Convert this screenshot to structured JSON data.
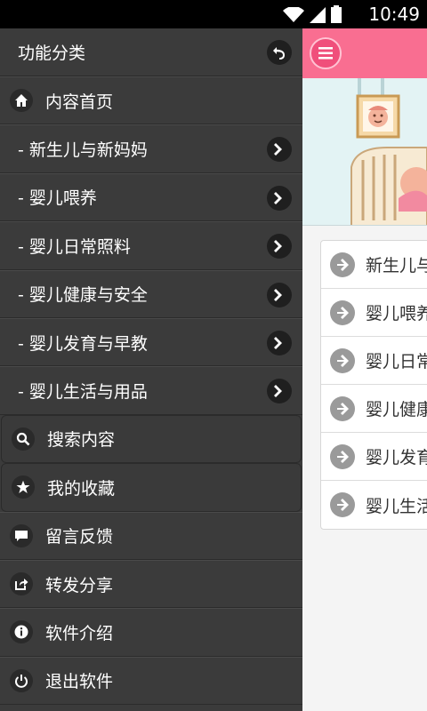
{
  "status_bar": {
    "time": "10:49",
    "icons": [
      "wifi-icon",
      "signal-icon",
      "battery-icon"
    ]
  },
  "colors": {
    "accent": "#f96e91",
    "drawer_bg": "#3b3b3b",
    "content_bg": "#f4f4f4"
  },
  "drawer": {
    "title": "功能分类",
    "header_icon": "undo-icon",
    "items": [
      {
        "label": "内容首页",
        "icon": "home-icon"
      },
      {
        "label": "- 新生儿与新妈妈",
        "has_chevron": true
      },
      {
        "label": "- 婴儿喂养",
        "has_chevron": true
      },
      {
        "label": "- 婴儿日常照料",
        "has_chevron": true
      },
      {
        "label": "- 婴儿健康与安全",
        "has_chevron": true
      },
      {
        "label": "- 婴儿发育与早教",
        "has_chevron": true
      },
      {
        "label": "- 婴儿生活与用品",
        "has_chevron": true
      },
      {
        "label": "搜索内容",
        "icon": "search-icon"
      },
      {
        "label": "我的收藏",
        "icon": "star-icon"
      },
      {
        "label": "留言反馈",
        "icon": "message-icon"
      },
      {
        "label": "转发分享",
        "icon": "share-icon"
      },
      {
        "label": "软件介绍",
        "icon": "info-icon"
      },
      {
        "label": "退出软件",
        "icon": "power-icon"
      }
    ]
  },
  "main": {
    "menu_icon": "hamburger-icon",
    "cards": [
      {
        "label": "新生儿与"
      },
      {
        "label": "婴儿喂养"
      },
      {
        "label": "婴儿日常"
      },
      {
        "label": "婴儿健康"
      },
      {
        "label": "婴儿发育"
      },
      {
        "label": "婴儿生活"
      }
    ]
  }
}
